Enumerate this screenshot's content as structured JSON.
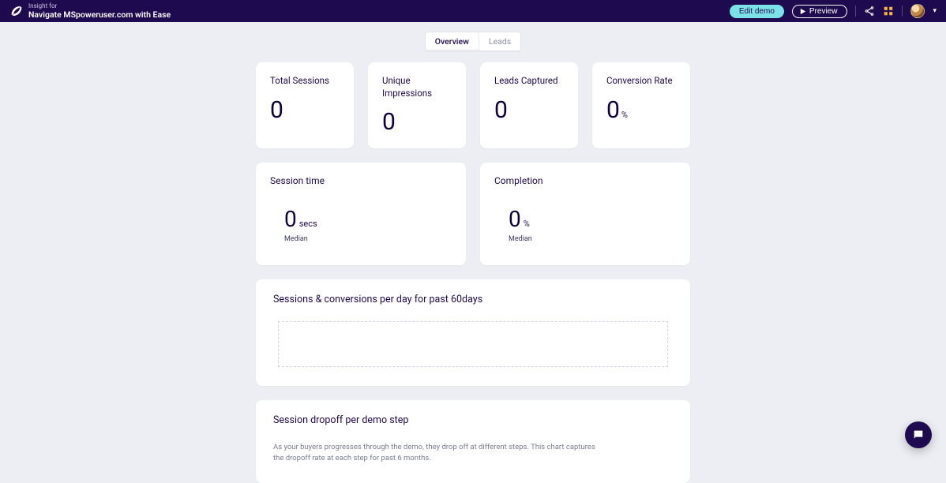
{
  "header": {
    "insight_label": "Insight for",
    "title": "Navigate MSpoweruser.com with Ease",
    "edit_label": "Edit demo",
    "preview_label": "Preview"
  },
  "tabs": {
    "overview": "Overview",
    "leads": "Leads"
  },
  "stats": [
    {
      "label": "Total Sessions",
      "value": "0",
      "unit": ""
    },
    {
      "label": "Unique Impressions",
      "value": "0",
      "unit": ""
    },
    {
      "label": "Leads Captured",
      "value": "0",
      "unit": ""
    },
    {
      "label": "Conversion Rate",
      "value": "0",
      "unit": "%"
    }
  ],
  "session_time": {
    "title": "Session time",
    "value": "0",
    "unit": "secs",
    "sub": "Median"
  },
  "completion": {
    "title": "Completion",
    "value": "0",
    "unit": "%",
    "sub": "Median"
  },
  "chart1": {
    "title": "Sessions & conversions per day for past 60days"
  },
  "chart2": {
    "title": "Session dropoff per demo step",
    "desc": "As your buyers progresses through the demo, they drop off at different steps. This chart captures the dropoff rate at each step for past 6 months."
  },
  "chart_data": [
    {
      "type": "line",
      "title": "Sessions & conversions per day for past 60days",
      "x": [],
      "series": []
    },
    {
      "type": "bar",
      "title": "Session dropoff per demo step",
      "categories": [],
      "values": []
    }
  ]
}
